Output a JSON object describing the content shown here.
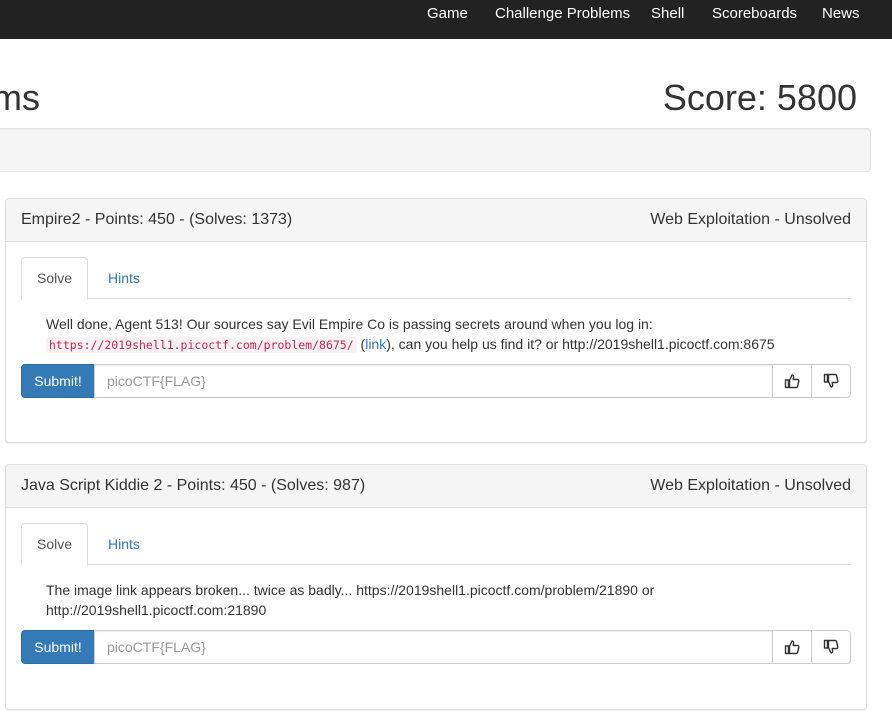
{
  "nav": {
    "items": [
      {
        "label": "Game"
      },
      {
        "label": "Challenge Problems"
      },
      {
        "label": "Shell"
      },
      {
        "label": "Scoreboards"
      },
      {
        "label": "News"
      }
    ]
  },
  "page": {
    "title": "ms",
    "score": "Score: 5800"
  },
  "problems": [
    {
      "heading": "Empire2 - Points: 450 - (Solves: 1373)",
      "category_status": "Web Exploitation - Unsolved",
      "tabs": {
        "solve": "Solve",
        "hints": "Hints"
      },
      "description": {
        "text1": "Well done, Agent 513! Our sources say Evil Empire Co is passing secrets around when you log in:",
        "code": "https://2019shell1.picoctf.com/problem/8675/",
        "link_open": " (",
        "link": "link",
        "text2": "), can you help us find it? or http://2019shell1.picoctf.com:8675"
      },
      "submit_label": "Submit!",
      "flag_placeholder": "picoCTF{FLAG}",
      "upvote_icon": "thumbs-up-icon",
      "downvote_icon": "thumbs-down-icon"
    },
    {
      "heading": "Java Script Kiddie 2 - Points: 450 - (Solves: 987)",
      "category_status": "Web Exploitation - Unsolved",
      "tabs": {
        "solve": "Solve",
        "hints": "Hints"
      },
      "description": {
        "text1": "The image link appears broken... twice as badly... https://2019shell1.picoctf.com/problem/21890 or http://2019shell1.picoctf.com:21890"
      },
      "submit_label": "Submit!",
      "flag_placeholder": "picoCTF{FLAG}",
      "upvote_icon": "thumbs-up-icon",
      "downvote_icon": "thumbs-down-icon"
    }
  ]
}
